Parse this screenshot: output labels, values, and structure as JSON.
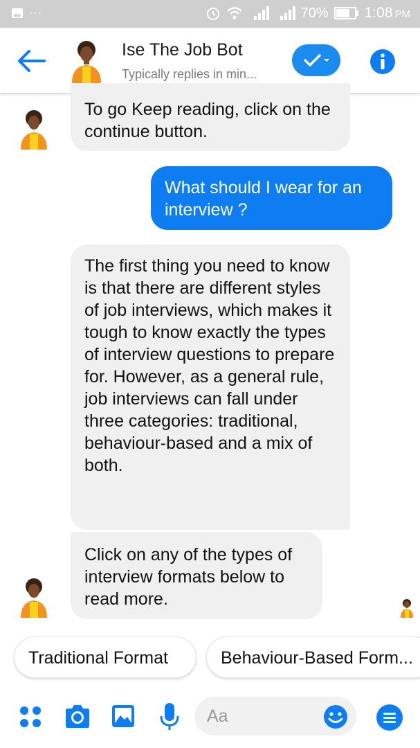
{
  "status_bar": {
    "battery": "70%",
    "time": "1:08",
    "ampm": "PM"
  },
  "header": {
    "title": "Ise The Job Bot",
    "subtitle": "Typically replies in min..."
  },
  "messages": [
    {
      "sender": "bot",
      "text": "To go Keep reading, click on the continue button."
    },
    {
      "sender": "user",
      "text": "What should I wear for an interview ?"
    },
    {
      "sender": "bot",
      "text": "The first thing you need to know is that there are different styles of job interviews, which makes it tough to know exactly the types of interview questions to prepare for. However, as a general rule, job interviews can fall under three categories: traditional, behaviour-based and a mix of both."
    },
    {
      "sender": "bot",
      "text": "Click on any of the types of interview formats below to read more."
    }
  ],
  "quick_replies": [
    "Traditional Format",
    "Behaviour-Based Form..."
  ],
  "composer": {
    "placeholder": "Aa"
  },
  "colors": {
    "accent": "#0f7df2",
    "bot_bubble": "#f0f0f0",
    "status_bar": "#cfcfcf"
  },
  "icons": [
    "back-arrow-icon",
    "check-icon",
    "info-icon",
    "apps-icon",
    "camera-icon",
    "image-icon",
    "microphone-icon",
    "emoji-icon",
    "menu-icon"
  ]
}
